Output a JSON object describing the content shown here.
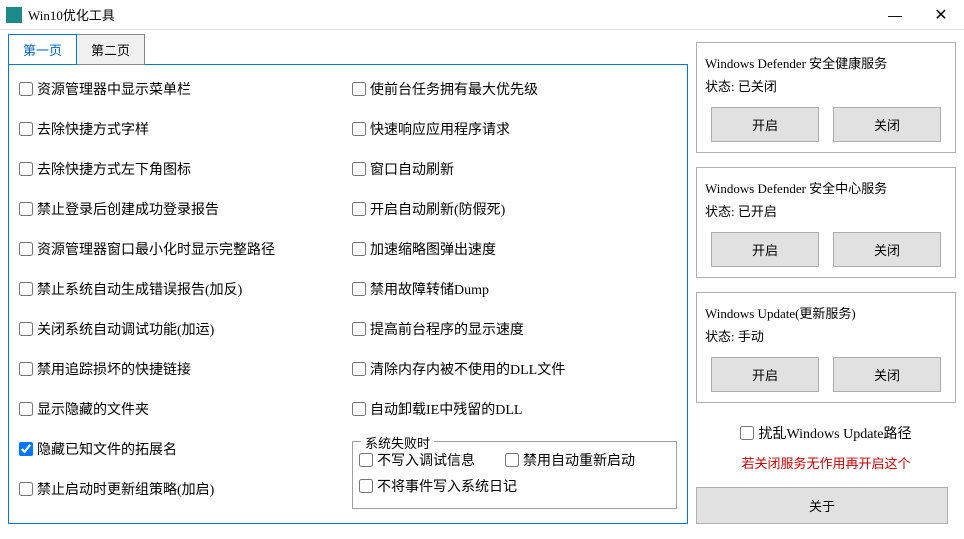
{
  "window": {
    "title": "Win10优化工具"
  },
  "tabs": {
    "page1": "第一页",
    "page2": "第二页"
  },
  "leftCol": [
    "资源管理器中显示菜单栏",
    "去除快捷方式字样",
    "去除快捷方式左下角图标",
    "禁止登录后创建成功登录报告",
    "资源管理器窗口最小化时显示完整路径",
    "禁止系统自动生成错误报告(加反)",
    "关闭系统自动调试功能(加运)",
    "禁用追踪损坏的快捷链接",
    "显示隐藏的文件夹",
    "隐藏已知文件的拓展名",
    "禁止启动时更新组策略(加启)"
  ],
  "leftColChecked": [
    false,
    false,
    false,
    false,
    false,
    false,
    false,
    false,
    false,
    true,
    false
  ],
  "rightCol": [
    "使前台任务拥有最大优先级",
    "快速响应应用程序请求",
    "窗口自动刷新",
    "开启自动刷新(防假死)",
    "加速缩略图弹出速度",
    "禁用故障转储Dump",
    "提高前台程序的显示速度",
    "清除内存内被不使用的DLL文件",
    "自动卸载IE中残留的DLL"
  ],
  "failBox": {
    "legend": "系统失败时",
    "items": [
      "不写入调试信息",
      "禁用自动重新启动",
      "不将事件写入系统日记"
    ]
  },
  "services": [
    {
      "title": "Windows Defender 安全健康服务",
      "statusLabel": "状态:",
      "statusValue": "已关闭",
      "on": "开启",
      "off": "关闭"
    },
    {
      "title": "Windows Defender 安全中心服务",
      "statusLabel": "状态:",
      "statusValue": "已开启",
      "on": "开启",
      "off": "关闭"
    },
    {
      "title": "Windows Update(更新服务)",
      "statusLabel": "状态:",
      "statusValue": "手动",
      "on": "开启",
      "off": "关闭"
    }
  ],
  "disturbCheckbox": "扰乱Windows Update路径",
  "warningText": "若关闭服务无作用再开启这个",
  "aboutButton": "关于"
}
